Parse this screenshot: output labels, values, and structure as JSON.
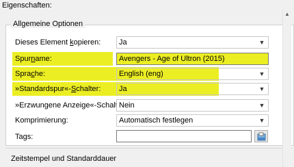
{
  "panel": {
    "caption": "Eigenschaften:"
  },
  "general": {
    "title": "Allgemeine Optionen",
    "copy": {
      "label_pre": "Dieses Element ",
      "label_key": "k",
      "label_post": "opieren:",
      "value": "Ja"
    },
    "trackname": {
      "label_pre": "Spur",
      "label_key": "n",
      "label_post": "ame:",
      "value": "Avengers - Age of Ultron (2015)"
    },
    "language": {
      "label_pre": "Spra",
      "label_key": "c",
      "label_post": "he:",
      "value": "English (eng)"
    },
    "default_track": {
      "label_pre": "»Standardspur«-",
      "label_key": "S",
      "label_post": "chalter:",
      "value": "Ja"
    },
    "forced": {
      "label": "»Erzwungene Anzeige«-Schalter:",
      "value": "Nein"
    },
    "compression": {
      "label": "Komprimierung:",
      "value": "Automatisch festlegen"
    },
    "tags": {
      "label": "Tags:",
      "value": ""
    }
  },
  "timestamps": {
    "title": "Zeitstempel und Standarddauer"
  },
  "highlight_color": "#ecee24",
  "icons": {
    "dropdown": "chevron-down-icon",
    "browse": "open-file-icon",
    "scroll": "scroll-up-icon"
  }
}
